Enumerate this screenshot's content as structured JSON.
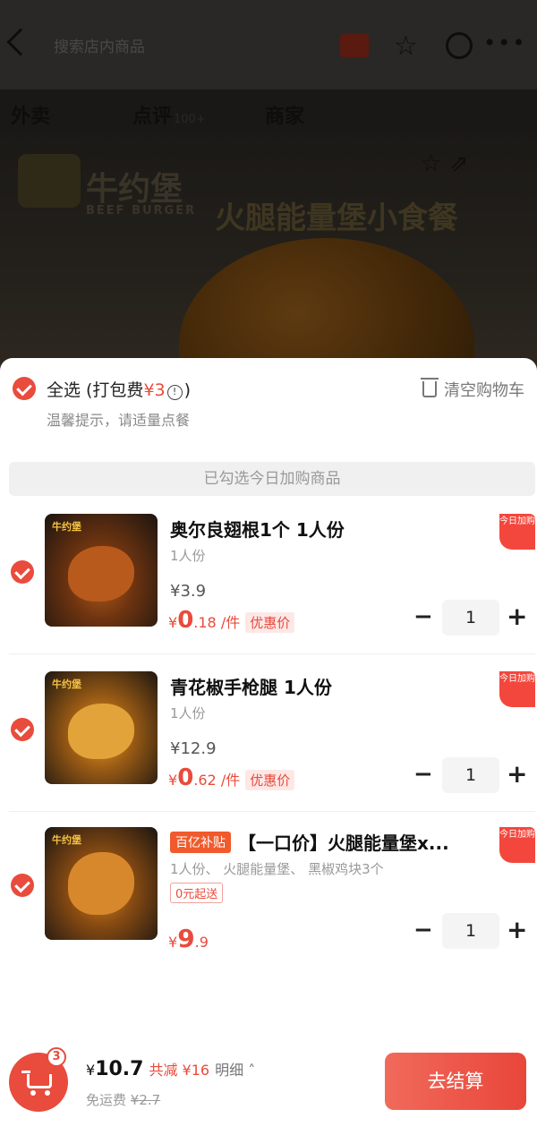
{
  "background": {
    "search_hint": "搜索店内商品",
    "tabs": [
      {
        "label": "外卖",
        "count": ""
      },
      {
        "label": "点评",
        "count": "100+"
      },
      {
        "label": "商家",
        "count": ""
      }
    ],
    "brand_name": "牛约堡",
    "brand_sub": "BEEF BURGER",
    "slogan": "火腿能量堡小食餐"
  },
  "sheet": {
    "select_all_label": "全选",
    "packing_fee_prefix": "(打包费",
    "packing_fee_value": "¥3",
    "packing_fee_suffix": ")",
    "info_icon_glyph": "!",
    "clear_label": "清空购物车",
    "tip": "温馨提示，请适量点餐",
    "strip_text": "已勾选今日加购商品",
    "ribbon_text": "今日加购"
  },
  "items": [
    {
      "name": "奥尔良翅根1个 1人份",
      "spec": "1人份",
      "original_price": "¥3.9",
      "discount_currency": "¥",
      "discount_int": "0",
      "discount_dec": ".18",
      "discount_unit": "/件",
      "promo_label": "优惠价",
      "qty": "1",
      "thumb_logo": "牛约堡"
    },
    {
      "name": "青花椒手枪腿 1人份",
      "spec": "1人份",
      "original_price": "¥12.9",
      "discount_currency": "¥",
      "discount_int": "0",
      "discount_dec": ".62",
      "discount_unit": "/件",
      "promo_label": "优惠价",
      "qty": "1",
      "thumb_logo": "牛约堡"
    },
    {
      "tag": "百亿补贴",
      "name": "【一口价】火腿能量堡x...",
      "spec": "1人份、 火腿能量堡、 黑椒鸡块3个",
      "free_ship": "0元起送",
      "price_currency": "¥",
      "price_int": "9",
      "price_dec": ".9",
      "qty": "1",
      "thumb_logo": "牛约堡"
    }
  ],
  "bottom": {
    "cart_count": "3",
    "currency": "¥",
    "total": "10.7",
    "saved": "共减 ¥16",
    "detail": "明细",
    "shipping_label": "免运费",
    "shipping_original": "¥2.7",
    "checkout_label": "去结算"
  },
  "colors": {
    "accent": "#e94b3c",
    "promo_bg": "#fde8e6",
    "subsidy_tag": "#f05a2c"
  },
  "icons": {
    "back": "back-arrow-icon",
    "star": "star-icon",
    "chat": "chat-icon",
    "more": "more-dots-icon",
    "trash": "trash-icon",
    "info": "info-icon",
    "cart": "cart-icon"
  }
}
